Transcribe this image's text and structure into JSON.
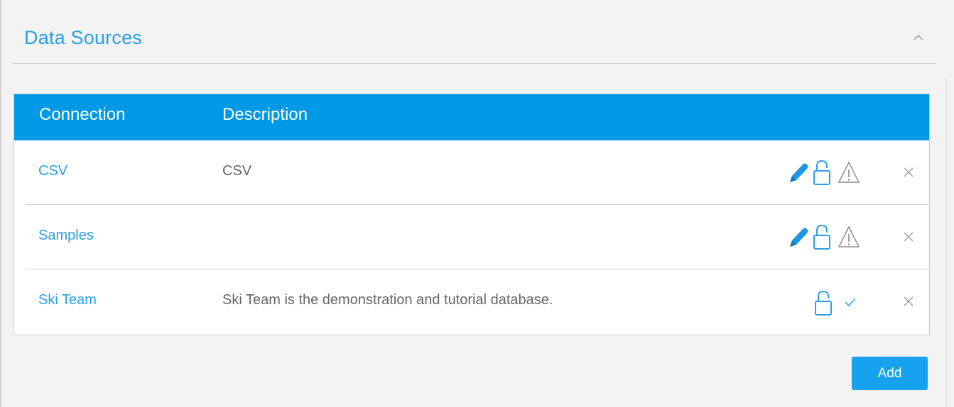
{
  "section": {
    "title": "Data Sources",
    "collapse_icon": "chevron-up-icon"
  },
  "table": {
    "columns": [
      "Connection",
      "Description"
    ],
    "rows": [
      {
        "name": "CSV",
        "description": "CSV",
        "actions": [
          "pencil-icon",
          "unlock-icon",
          "warning-icon",
          "close-icon"
        ]
      },
      {
        "name": "Samples",
        "description": "",
        "actions": [
          "pencil-icon",
          "unlock-icon",
          "warning-icon",
          "close-icon"
        ]
      },
      {
        "name": "Ski Team",
        "description": "Ski Team is the demonstration and tutorial database.",
        "actions": [
          "unlock-icon",
          "check-icon",
          "close-icon"
        ]
      }
    ]
  },
  "actions": {
    "add_label": "Add"
  },
  "colors": {
    "accent": "#0099e6",
    "link": "#2aa0ea",
    "button": "#16a2ef",
    "text_muted": "#666666",
    "icon_grey": "#9a9a9a"
  }
}
